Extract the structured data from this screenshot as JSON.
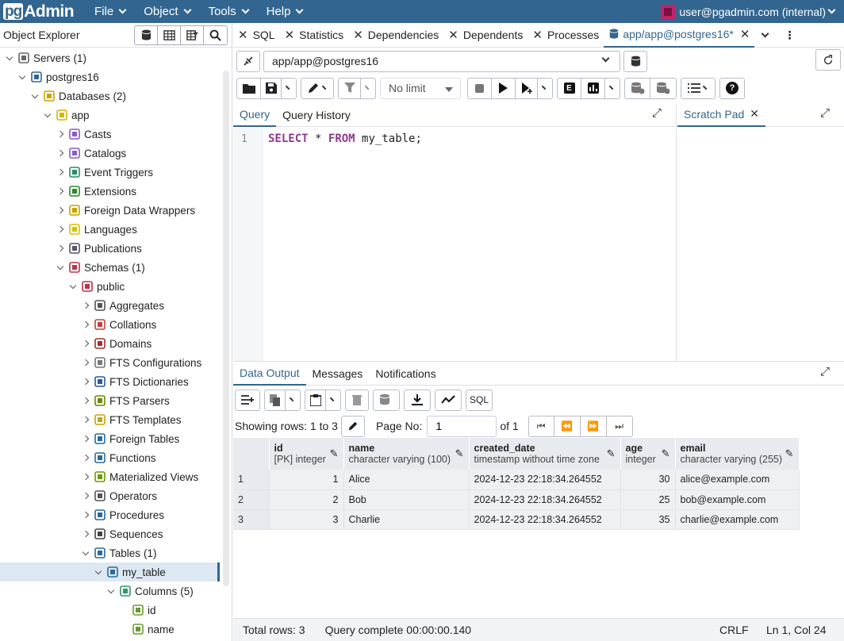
{
  "app": {
    "logo_pg": "pg",
    "logo_admin": "Admin",
    "user": "user@pgadmin.com (internal)"
  },
  "menu": [
    {
      "label": "File"
    },
    {
      "label": "Object"
    },
    {
      "label": "Tools"
    },
    {
      "label": "Help"
    }
  ],
  "explorer": {
    "title": "Object Explorer",
    "tree": [
      {
        "label": "Servers",
        "count": "(1)",
        "level": 0,
        "state": "open",
        "icon": "servers-icon"
      },
      {
        "label": "postgres16",
        "count": "",
        "level": 1,
        "state": "open",
        "icon": "elephant-icon"
      },
      {
        "label": "Databases",
        "count": "(2)",
        "level": 2,
        "state": "open",
        "icon": "databases-icon"
      },
      {
        "label": "app",
        "count": "",
        "level": 3,
        "state": "open",
        "icon": "database-icon"
      },
      {
        "label": "Casts",
        "count": "",
        "level": 4,
        "state": "closed",
        "icon": "casts-icon"
      },
      {
        "label": "Catalogs",
        "count": "",
        "level": 4,
        "state": "closed",
        "icon": "catalogs-icon"
      },
      {
        "label": "Event Triggers",
        "count": "",
        "level": 4,
        "state": "closed",
        "icon": "event-triggers-icon"
      },
      {
        "label": "Extensions",
        "count": "",
        "level": 4,
        "state": "closed",
        "icon": "extensions-icon"
      },
      {
        "label": "Foreign Data Wrappers",
        "count": "",
        "level": 4,
        "state": "closed",
        "icon": "fdw-icon"
      },
      {
        "label": "Languages",
        "count": "",
        "level": 4,
        "state": "closed",
        "icon": "languages-icon"
      },
      {
        "label": "Publications",
        "count": "",
        "level": 4,
        "state": "closed",
        "icon": "publications-icon"
      },
      {
        "label": "Schemas",
        "count": "(1)",
        "level": 4,
        "state": "open",
        "icon": "schemas-icon"
      },
      {
        "label": "public",
        "count": "",
        "level": 5,
        "state": "open",
        "icon": "schema-icon"
      },
      {
        "label": "Aggregates",
        "count": "",
        "level": 6,
        "state": "closed",
        "icon": "aggregates-icon"
      },
      {
        "label": "Collations",
        "count": "",
        "level": 6,
        "state": "closed",
        "icon": "collations-icon"
      },
      {
        "label": "Domains",
        "count": "",
        "level": 6,
        "state": "closed",
        "icon": "domains-icon"
      },
      {
        "label": "FTS Configurations",
        "count": "",
        "level": 6,
        "state": "closed",
        "icon": "fts-config-icon"
      },
      {
        "label": "FTS Dictionaries",
        "count": "",
        "level": 6,
        "state": "closed",
        "icon": "fts-dict-icon"
      },
      {
        "label": "FTS Parsers",
        "count": "",
        "level": 6,
        "state": "closed",
        "icon": "fts-parser-icon"
      },
      {
        "label": "FTS Templates",
        "count": "",
        "level": 6,
        "state": "closed",
        "icon": "fts-template-icon"
      },
      {
        "label": "Foreign Tables",
        "count": "",
        "level": 6,
        "state": "closed",
        "icon": "foreign-table-icon"
      },
      {
        "label": "Functions",
        "count": "",
        "level": 6,
        "state": "closed",
        "icon": "function-icon"
      },
      {
        "label": "Materialized Views",
        "count": "",
        "level": 6,
        "state": "closed",
        "icon": "mview-icon"
      },
      {
        "label": "Operators",
        "count": "",
        "level": 6,
        "state": "closed",
        "icon": "operator-icon"
      },
      {
        "label": "Procedures",
        "count": "",
        "level": 6,
        "state": "closed",
        "icon": "procedure-icon"
      },
      {
        "label": "Sequences",
        "count": "",
        "level": 6,
        "state": "closed",
        "icon": "sequence-icon"
      },
      {
        "label": "Tables",
        "count": "(1)",
        "level": 6,
        "state": "open",
        "icon": "tables-icon"
      },
      {
        "label": "my_table",
        "count": "",
        "level": 7,
        "state": "open",
        "icon": "table-icon",
        "selected": true
      },
      {
        "label": "Columns",
        "count": "(5)",
        "level": 8,
        "state": "open",
        "icon": "columns-icon"
      },
      {
        "label": "id",
        "count": "",
        "level": 9,
        "state": "leaf",
        "icon": "column-icon"
      },
      {
        "label": "name",
        "count": "",
        "level": 9,
        "state": "leaf",
        "icon": "column-icon"
      }
    ]
  },
  "tabs": [
    {
      "label": "SQL"
    },
    {
      "label": "Statistics"
    },
    {
      "label": "Dependencies"
    },
    {
      "label": "Dependents"
    },
    {
      "label": "Processes"
    },
    {
      "label": "app/app@postgres16*",
      "active": true
    }
  ],
  "connection": {
    "value": "app/app@postgres16"
  },
  "toolbar": {
    "limit": "No limit"
  },
  "editor": {
    "tabs": [
      {
        "label": "Query"
      },
      {
        "label": "Query History"
      }
    ],
    "line_number": "1",
    "sql": {
      "kw1": "SELECT",
      "star": "*",
      "kw2": "FROM",
      "ident": "my_table",
      "end": ";"
    },
    "scratch_label": "Scratch Pad"
  },
  "results": {
    "tabs": [
      {
        "label": "Data Output"
      },
      {
        "label": "Messages"
      },
      {
        "label": "Notifications"
      }
    ],
    "sql_label": "SQL",
    "showing": "Showing rows: 1 to 3",
    "page_label": "Page No:",
    "page_value": "1",
    "of_label": "of 1",
    "columns": [
      {
        "name": "id",
        "type": "[PK] integer"
      },
      {
        "name": "name",
        "type": "character varying (100)"
      },
      {
        "name": "created_date",
        "type": "timestamp without time zone"
      },
      {
        "name": "age",
        "type": "integer"
      },
      {
        "name": "email",
        "type": "character varying (255)"
      }
    ],
    "rows": [
      {
        "n": "1",
        "id": "1",
        "name": "Alice",
        "created_date": "2024-12-23 22:18:34.264552",
        "age": "30",
        "email": "alice@example.com"
      },
      {
        "n": "2",
        "id": "2",
        "name": "Bob",
        "created_date": "2024-12-23 22:18:34.264552",
        "age": "25",
        "email": "bob@example.com"
      },
      {
        "n": "3",
        "id": "3",
        "name": "Charlie",
        "created_date": "2024-12-23 22:18:34.264552",
        "age": "35",
        "email": "charlie@example.com"
      }
    ]
  },
  "status": {
    "total": "Total rows: 3",
    "query": "Query complete 00:00:00.140",
    "eol": "CRLF",
    "pos": "Ln 1, Col 24"
  },
  "colors": {
    "brand": "#326690",
    "selected_row": "#dde8f3"
  }
}
